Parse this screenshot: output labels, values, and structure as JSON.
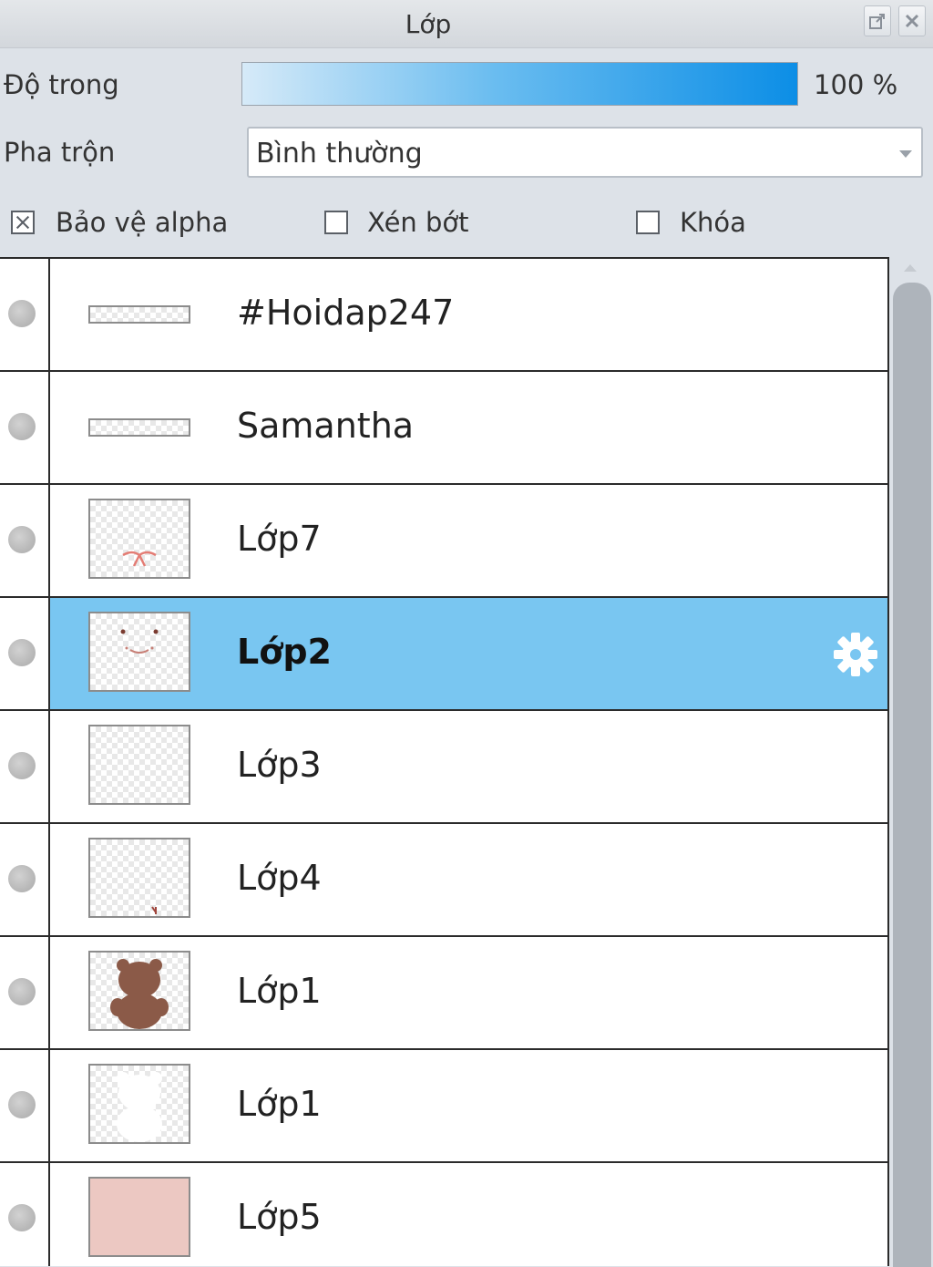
{
  "panel": {
    "title": "Lớp",
    "popout_icon": "popout-icon",
    "close_icon": "close-icon"
  },
  "opacity": {
    "label": "Độ trong",
    "value_text": "100 %",
    "value": 100
  },
  "blend": {
    "label": "Pha trộn",
    "selected": "Bình thường"
  },
  "options": {
    "alpha_protect": {
      "label": "Bảo vệ alpha",
      "checked": true
    },
    "clip": {
      "label": "Xén bớt",
      "checked": false
    },
    "lock": {
      "label": "Khóa",
      "checked": false
    }
  },
  "layers": [
    {
      "name": "#Hoidap247",
      "thumb": "text-strip",
      "selected": false
    },
    {
      "name": "Samantha",
      "thumb": "text-strip",
      "selected": false
    },
    {
      "name": "Lớp7",
      "thumb": "ribbon-sketch",
      "selected": false
    },
    {
      "name": "Lớp2",
      "thumb": "face-sketch",
      "selected": true,
      "icon": "gear-icon"
    },
    {
      "name": "Lớp3",
      "thumb": "empty",
      "selected": false
    },
    {
      "name": "Lớp4",
      "thumb": "small-mark",
      "selected": false
    },
    {
      "name": "Lớp1",
      "thumb": "bear",
      "selected": false
    },
    {
      "name": "Lớp1",
      "thumb": "white-blob",
      "selected": false
    },
    {
      "name": "Lớp5",
      "thumb": "pink-fill",
      "selected": false
    }
  ],
  "colors": {
    "selected_row": "#79c6f1",
    "bear": "#8b5a48",
    "pink_fill": "#ecc8c2"
  }
}
